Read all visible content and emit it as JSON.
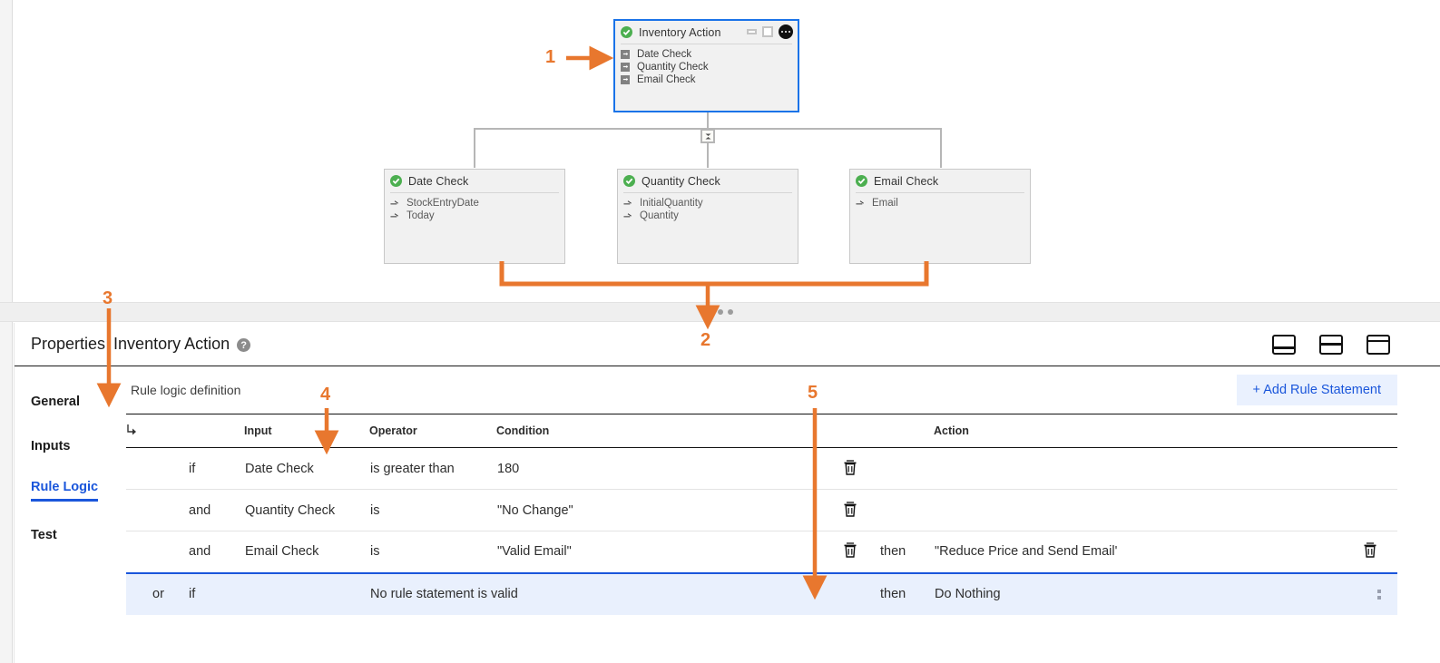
{
  "canvas": {
    "root_node": {
      "title": "Inventory Action",
      "status_icon": "check-circle-icon",
      "controls": [
        "minimize-icon",
        "maximize-icon",
        "more-options-icon"
      ],
      "items": [
        "Date Check",
        "Quantity Check",
        "Email Check"
      ]
    },
    "child_nodes": [
      {
        "title": "Date Check",
        "status_icon": "check-circle-icon",
        "items": [
          "StockEntryDate",
          "Today"
        ]
      },
      {
        "title": "Quantity Check",
        "status_icon": "check-circle-icon",
        "items": [
          "InitialQuantity",
          "Quantity"
        ]
      },
      {
        "title": "Email Check",
        "status_icon": "check-circle-icon",
        "items": [
          "Email"
        ]
      }
    ],
    "connector_toggle_icon": "collapse-toggle-icon"
  },
  "divider": {
    "handle_icon": "drag-handle-dots-icon"
  },
  "properties": {
    "title": "Properties",
    "subtitle": "Inventory Action",
    "help_icon": "help-circle-icon",
    "help_glyph": "?",
    "layout_icons": [
      "layout-bottom-icon",
      "layout-split-icon",
      "layout-top-icon"
    ],
    "tabs": [
      {
        "label": "General",
        "active": false
      },
      {
        "label": "Inputs",
        "active": false
      },
      {
        "label": "Rule Logic",
        "active": true
      },
      {
        "label": "Test",
        "active": false
      }
    ],
    "section_label": "Rule logic definition",
    "add_button": "+ Add Rule Statement",
    "table": {
      "branch_icon": "branch-arrow-icon",
      "columns": [
        "Input",
        "Operator",
        "Condition",
        "Action"
      ],
      "rows": [
        {
          "or": "",
          "if": "if",
          "input": "Date Check",
          "operator": "is greater than",
          "condition": "180",
          "delete_icon": "trash-icon",
          "then": "",
          "action": "",
          "action_delete_icon": "",
          "menu_icon": "",
          "selected": false
        },
        {
          "or": "",
          "if": "and",
          "input": "Quantity Check",
          "operator": "is",
          "condition": "\"No Change\"",
          "delete_icon": "trash-icon",
          "then": "",
          "action": "",
          "action_delete_icon": "",
          "menu_icon": "",
          "selected": false
        },
        {
          "or": "",
          "if": "and",
          "input": "Email Check",
          "operator": "is",
          "condition": "\"Valid Email\"",
          "delete_icon": "trash-icon",
          "then": "then",
          "action": "\"Reduce Price and Send Email'",
          "action_delete_icon": "trash-icon",
          "menu_icon": "",
          "selected": false
        },
        {
          "or": "or",
          "if": "if",
          "input": "",
          "operator": "No rule statement is valid",
          "condition": "",
          "delete_icon": "",
          "then": "then",
          "action": "Do Nothing",
          "action_delete_icon": "",
          "menu_icon": "more-vertical-icon",
          "selected": true
        }
      ]
    }
  },
  "annotations": {
    "color": "#e8772e",
    "markers": [
      {
        "number": "1",
        "target": "root-node"
      },
      {
        "number": "2",
        "target": "divider-handle"
      },
      {
        "number": "3",
        "target": "properties-tabs"
      },
      {
        "number": "4",
        "target": "rule-table-input-column"
      },
      {
        "number": "5",
        "target": "rule-table-default-row"
      }
    ]
  }
}
